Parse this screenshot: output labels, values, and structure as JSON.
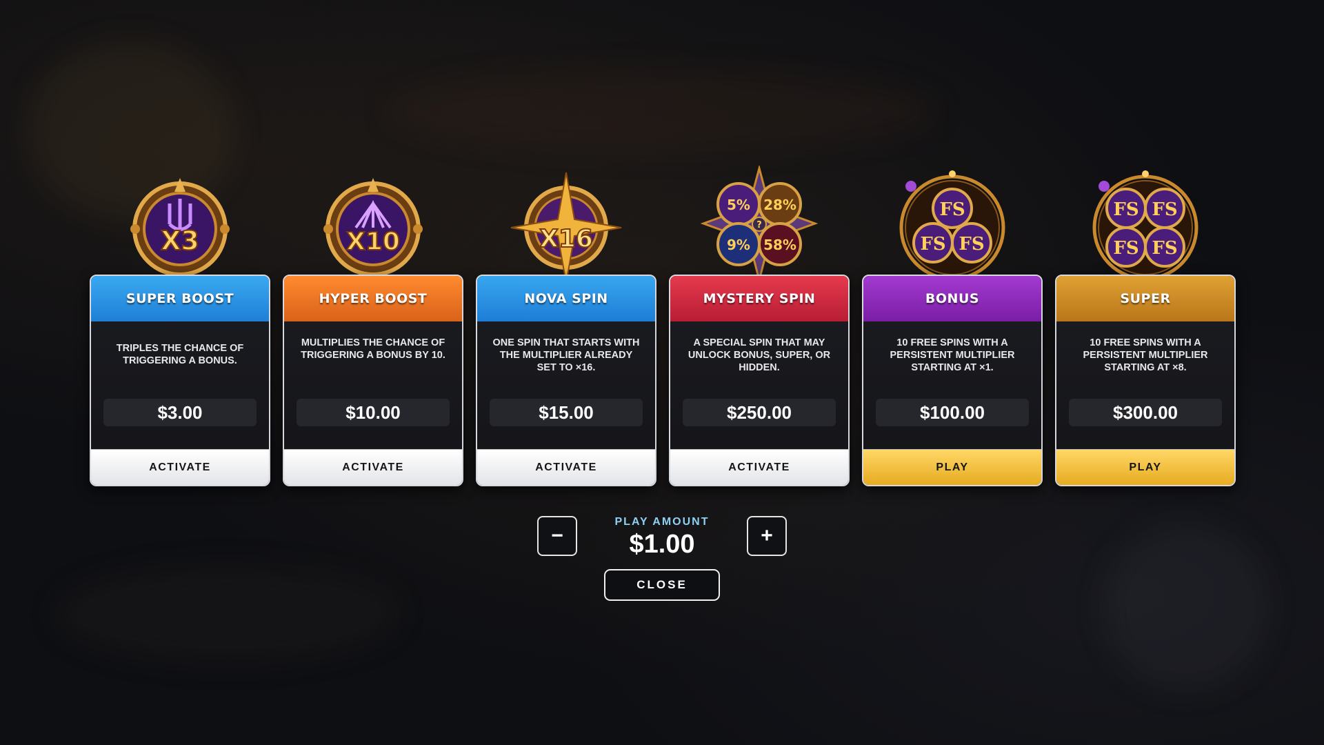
{
  "cards": [
    {
      "title": "SUPER BOOST",
      "emblem_text": "X3",
      "emblem_icon": "trident-icon",
      "header_color_top": "#3aa9f0",
      "header_color_bottom": "#1f7fd6",
      "description": "TRIPLES THE CHANCE OF TRIGGERING A BONUS.",
      "price": "$3.00",
      "button_label": "ACTIVATE"
    },
    {
      "title": "HYPER BOOST",
      "emblem_text": "X10",
      "emblem_icon": "shell-icon",
      "header_color_top": "#ff8a2e",
      "header_color_bottom": "#d9621a",
      "description": "MULTIPLIES THE CHANCE OF TRIGGERING A BONUS BY 10.",
      "price": "$10.00",
      "button_label": "ACTIVATE"
    },
    {
      "title": "NOVA SPIN",
      "emblem_text": "X16",
      "emblem_icon": "star-icon",
      "header_color_top": "#38a6ef",
      "header_color_bottom": "#1e7ed6",
      "description": "ONE SPIN THAT STARTS WITH THE MULTIPLIER ALREADY SET TO ×16.",
      "price": "$15.00",
      "button_label": "ACTIVATE"
    },
    {
      "title": "MYSTERY SPIN",
      "emblem_texts": [
        "5%",
        "28%",
        "9%",
        "58%"
      ],
      "emblem_icon": "mystery-wheel-icon",
      "header_color_top": "#e53a4e",
      "header_color_bottom": "#b81d34",
      "description": "A SPECIAL SPIN THAT MAY UNLOCK BONUS, SUPER, OR HIDDEN.",
      "price": "$250.00",
      "button_label": "ACTIVATE"
    },
    {
      "title": "BONUS",
      "emblem_texts": [
        "FS",
        "FS",
        "FS"
      ],
      "emblem_icon": "free-spins-icon",
      "header_color_top": "#a33ad0",
      "header_color_bottom": "#7a1ea6",
      "description": "10 FREE SPINS WITH A PERSISTENT MULTIPLIER STARTING AT ×1.",
      "price": "$100.00",
      "button_label": "PLAY"
    },
    {
      "title": "SUPER",
      "emblem_texts": [
        "FS",
        "FS",
        "FS",
        "FS"
      ],
      "emblem_icon": "super-free-spins-icon",
      "header_color_top": "#e0a133",
      "header_color_bottom": "#b9761a",
      "description": "10 FREE SPINS WITH A PERSISTENT MULTIPLIER STARTING AT ×8.",
      "price": "$300.00",
      "button_label": "PLAY"
    }
  ],
  "play_amount": {
    "label": "PLAY AMOUNT",
    "value": "$1.00",
    "decrease_symbol": "−",
    "increase_symbol": "+"
  },
  "close_label": "CLOSE"
}
